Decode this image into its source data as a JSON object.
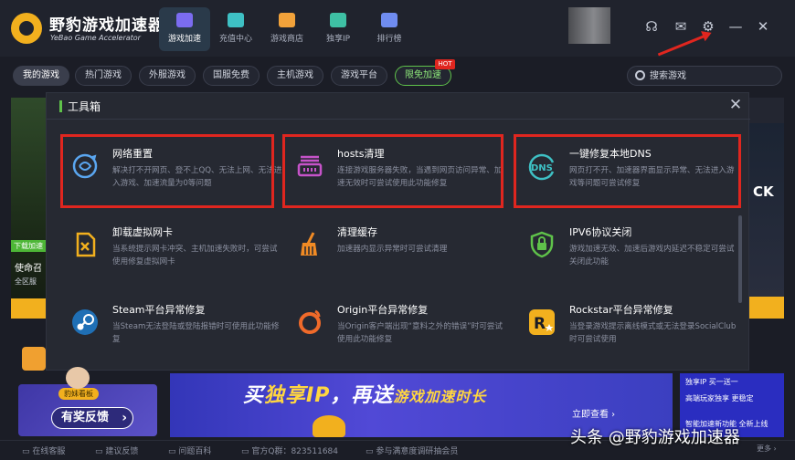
{
  "app": {
    "name": "野豹游戏加速器",
    "name_en": "YeBao Game Accelerator"
  },
  "nav_tabs": [
    {
      "label": "游戏加速",
      "icon": "gamepad-icon"
    },
    {
      "label": "充值中心",
      "icon": "card-icon"
    },
    {
      "label": "游戏商店",
      "icon": "shop-icon"
    },
    {
      "label": "独享IP",
      "icon": "ip-icon"
    },
    {
      "label": "排行榜",
      "icon": "ranking-icon"
    }
  ],
  "header_icons": [
    "headset-icon",
    "mail-icon",
    "gear-icon",
    "minimize-icon",
    "close-icon"
  ],
  "filters": [
    "我的游戏",
    "热门游戏",
    "外服游戏",
    "国服免费",
    "主机游戏",
    "游戏平台",
    "限免加速"
  ],
  "hot_badge": "HOT",
  "search": {
    "placeholder": "搜索游戏"
  },
  "background_card": {
    "tag": "下载加速",
    "name": "使命召",
    "server": "全区服",
    "right_text": "CK"
  },
  "toolbox": {
    "title": "工具箱",
    "tools": [
      {
        "title": "网络重置",
        "desc": "解决打不开网页、登不上QQ、无法上网、无法进入游戏、加速流量为0等问题",
        "icon": "network-reset-icon",
        "highlight": true
      },
      {
        "title": "hosts清理",
        "desc": "连接游戏服务器失败，当遇到网页访问异常、加速无效时可尝试使用此功能修复",
        "icon": "hosts-icon",
        "highlight": true
      },
      {
        "title": "一键修复本地DNS",
        "desc": "网页打不开、加速器界面显示异常、无法进入游戏等问题可尝试修复",
        "icon": "dns-icon",
        "highlight": true
      },
      {
        "title": "卸载虚拟网卡",
        "desc": "当系统提示网卡冲突、主机加速失败时，可尝试使用修复虚拟网卡",
        "icon": "uninstall-nic-icon",
        "highlight": false
      },
      {
        "title": "清理缓存",
        "desc": "加速器内显示异常时可尝试清理",
        "icon": "broom-icon",
        "highlight": false
      },
      {
        "title": "IPV6协议关闭",
        "desc": "游戏加速无效、加速后游戏内延迟不稳定可尝试关闭此功能",
        "icon": "shield-lock-icon",
        "highlight": false
      },
      {
        "title": "Steam平台异常修复",
        "desc": "当Steam无法登陆或登陆报错时可使用此功能修复",
        "icon": "steam-icon",
        "highlight": false
      },
      {
        "title": "Origin平台异常修复",
        "desc": "当Origin客户端出现“意料之外的错误”时可尝试使用此功能修复",
        "icon": "origin-icon",
        "highlight": false
      },
      {
        "title": "Rockstar平台异常修复",
        "desc": "当登录游戏提示离线模式或无法登录SocialClub时可尝试使用",
        "icon": "rockstar-icon",
        "highlight": false
      }
    ]
  },
  "feedback": {
    "tag": "豹妹看板",
    "button": "有奖反馈"
  },
  "promo": {
    "title_a": "买",
    "title_b": "独享IP",
    "title_c": "，再送",
    "title_d": "游戏加速时长",
    "sub": "立即查看 ›",
    "side_lines": [
      "独享IP  买一送一",
      "高端玩家独享  更稳定",
      "智能加速新功能  全新上线"
    ]
  },
  "statusbar": {
    "online_service": "在线客服",
    "suggestion": "建议反馈",
    "faq": "问题百科",
    "qq_group": "官方Q群：823511684",
    "survey": "参与满意度调研抽会员",
    "more": "更多 ›"
  },
  "watermark": "头条 @野豹游戏加速器",
  "colors": {
    "accent_green": "#5fc24a",
    "highlight_red": "#e0261f",
    "brand_yellow": "#f2b01e"
  }
}
